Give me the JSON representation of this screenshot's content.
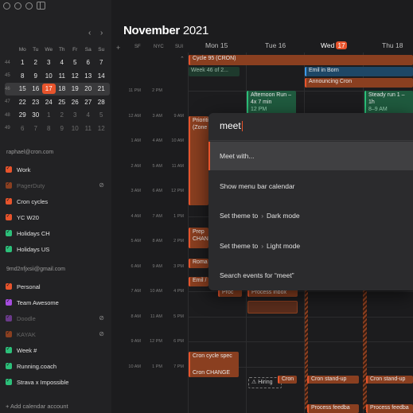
{
  "window": {
    "title": "November 2021"
  },
  "header": {
    "month": "November",
    "year": "2021"
  },
  "mini_calendar": {
    "nav_prev": "‹",
    "nav_next": "›",
    "weekdays": [
      "Mo",
      "Tu",
      "We",
      "Th",
      "Fr",
      "Sa",
      "Su"
    ],
    "weeks": [
      {
        "num": "44",
        "days": [
          "1",
          "2",
          "3",
          "4",
          "5",
          "6",
          "7"
        ]
      },
      {
        "num": "45",
        "days": [
          "8",
          "9",
          "10",
          "11",
          "12",
          "13",
          "14"
        ]
      },
      {
        "num": "46",
        "days": [
          "15",
          "16",
          "17",
          "18",
          "19",
          "20",
          "21"
        ]
      },
      {
        "num": "47",
        "days": [
          "22",
          "23",
          "24",
          "25",
          "26",
          "27",
          "28"
        ]
      },
      {
        "num": "48",
        "days": [
          "29",
          "30",
          "1",
          "2",
          "3",
          "4",
          "5"
        ]
      },
      {
        "num": "49",
        "days": [
          "6",
          "7",
          "8",
          "9",
          "10",
          "11",
          "12"
        ]
      }
    ],
    "today": "17"
  },
  "accounts": [
    {
      "email": "raphael@cron.com",
      "calendars": [
        {
          "label": "Work",
          "color": "#e8542c",
          "enabled": true,
          "hidden": false
        },
        {
          "label": "PagerDuty",
          "color": "#8a3f20",
          "enabled": false,
          "hidden": true
        },
        {
          "label": "Cron cycles",
          "color": "#e8542c",
          "enabled": true,
          "hidden": false
        },
        {
          "label": "YC W20",
          "color": "#e8542c",
          "enabled": true,
          "hidden": false
        },
        {
          "label": "Holidays CH",
          "color": "#2cc07a",
          "enabled": true,
          "hidden": false
        },
        {
          "label": "Holidays US",
          "color": "#2cc07a",
          "enabled": true,
          "hidden": false
        }
      ]
    },
    {
      "email": "9md2nfjxsii@gmail.com",
      "calendars": [
        {
          "label": "Personal",
          "color": "#e8542c",
          "enabled": true,
          "hidden": false
        },
        {
          "label": "Team Awesome",
          "color": "#a64de0",
          "enabled": true,
          "hidden": false
        },
        {
          "label": "Doodle",
          "color": "#6a3a8a",
          "enabled": false,
          "hidden": true
        },
        {
          "label": "KAYAK",
          "color": "#8a3f20",
          "enabled": false,
          "hidden": true
        },
        {
          "label": "Week #",
          "color": "#2cc07a",
          "enabled": true,
          "hidden": false
        },
        {
          "label": "Running.coach",
          "color": "#2cc07a",
          "enabled": true,
          "hidden": false
        },
        {
          "label": "Strava x Impossible",
          "color": "#2cc07a",
          "enabled": true,
          "hidden": false
        }
      ]
    }
  ],
  "add_calendar": "+ Add calendar account",
  "timezones": [
    "SF",
    "NYC",
    "SUI"
  ],
  "add_tz": "+",
  "days": [
    {
      "label": "Mon 15"
    },
    {
      "label": "Tue 16"
    },
    {
      "label": "Wed",
      "badge": "17"
    },
    {
      "label": "Thu 18"
    }
  ],
  "hours": [
    {
      "sf": "11 PM",
      "nyc": "2 PM",
      "sui": ""
    },
    {
      "sf": "12 AM",
      "nyc": "3 AM",
      "sui": "9 AM"
    },
    {
      "sf": "1 AM",
      "nyc": "4 AM",
      "sui": "10 AM"
    },
    {
      "sf": "2 AM",
      "nyc": "5 AM",
      "sui": "11 AM"
    },
    {
      "sf": "3 AM",
      "nyc": "6 AM",
      "sui": "12 PM"
    },
    {
      "sf": "4 AM",
      "nyc": "7 AM",
      "sui": "1 PM"
    },
    {
      "sf": "5 AM",
      "nyc": "8 AM",
      "sui": "2 PM"
    },
    {
      "sf": "6 AM",
      "nyc": "9 AM",
      "sui": "3 PM"
    },
    {
      "sf": "7 AM",
      "nyc": "10 AM",
      "sui": "4 PM"
    },
    {
      "sf": "8 AM",
      "nyc": "11 AM",
      "sui": "5 PM"
    },
    {
      "sf": "9 AM",
      "nyc": "12 PM",
      "sui": "6 PM"
    },
    {
      "sf": "10 AM",
      "nyc": "1 PM",
      "sui": "7 PM"
    }
  ],
  "events": {
    "cycle": "Cycle 95 (CRON)",
    "week": "Week 46 of 2...",
    "emil": "Emil in Born",
    "announcing": "Announcing Cron",
    "afternoon_run": "Afternoon Run – 4x 7 min",
    "afternoon_time": "12 PM",
    "steady_run": "Steady run 1 – 1h",
    "steady_time": "8–9 AM",
    "priorities": "Prioriti (Zone",
    "prep": "Prep CHANGE",
    "roma": "Roma",
    "emil_short": "Emil /",
    "proc1": "Proc",
    "proc_inbox": "Process inbox",
    "cron_cycle_spec": "Cron cycle spec",
    "cron_change": "Cron CHANGE",
    "hiring": "⚠ Hiring",
    "cron_short": "Cron",
    "standup1": "Cron stand-up",
    "standup2": "Cron stand-up",
    "feedback1": "Process feedba",
    "feedback2": "Process feedba"
  },
  "palette": {
    "query": "meet",
    "items": [
      {
        "label": "Meet with...",
        "active": true
      },
      {
        "label": "Show menu bar calendar",
        "active": false
      },
      {
        "label": "Set theme to",
        "arrow": "›",
        "suffix": "Dark mode",
        "active": false
      },
      {
        "label": "Set theme to",
        "arrow": "›",
        "suffix": "Light mode",
        "active": false
      },
      {
        "label": "Search events for “meet”",
        "active": false
      }
    ]
  }
}
